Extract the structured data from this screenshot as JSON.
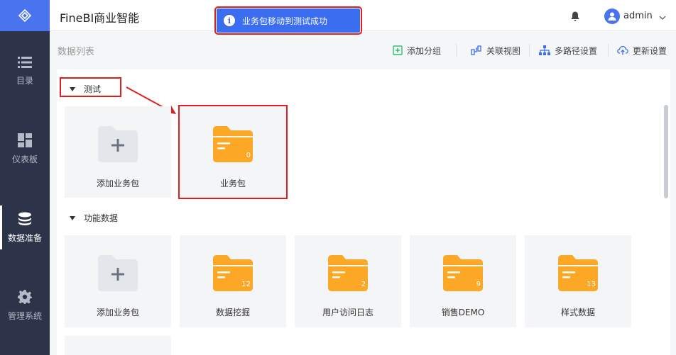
{
  "app": {
    "title": "FineBI商业智能"
  },
  "toast": {
    "icon": "info-icon",
    "text": "业务包移动到测试成功"
  },
  "header": {
    "user": "admin"
  },
  "sidebar": {
    "items": [
      {
        "label": "目录",
        "icon": "list-icon"
      },
      {
        "label": "仪表板",
        "icon": "dashboard-icon"
      },
      {
        "label": "数据准备",
        "icon": "database-icon"
      },
      {
        "label": "管理系统",
        "icon": "gear-icon"
      }
    ]
  },
  "toolbar": {
    "list_title": "数据列表",
    "add_group": "添加分组",
    "relation_view": "关联视图",
    "multi_path": "多路径设置",
    "update_settings": "更新设置"
  },
  "groups": [
    {
      "name": "测试",
      "cards": [
        {
          "type": "add",
          "name": "添加业务包"
        },
        {
          "type": "folder",
          "name": "业务包",
          "count": "0"
        }
      ]
    },
    {
      "name": "功能数据",
      "cards": [
        {
          "type": "add",
          "name": "添加业务包"
        },
        {
          "type": "folder",
          "name": "数据挖掘",
          "count": "12"
        },
        {
          "type": "folder",
          "name": "用户访问日志",
          "count": "2"
        },
        {
          "type": "folder",
          "name": "销售DEMO",
          "count": "9"
        },
        {
          "type": "folder",
          "name": "样式数据",
          "count": "13"
        }
      ]
    }
  ],
  "colors": {
    "accent": "#4a73f0",
    "folder": "#fca826",
    "sidebar": "#2d3449",
    "highlight": "#e02020"
  }
}
